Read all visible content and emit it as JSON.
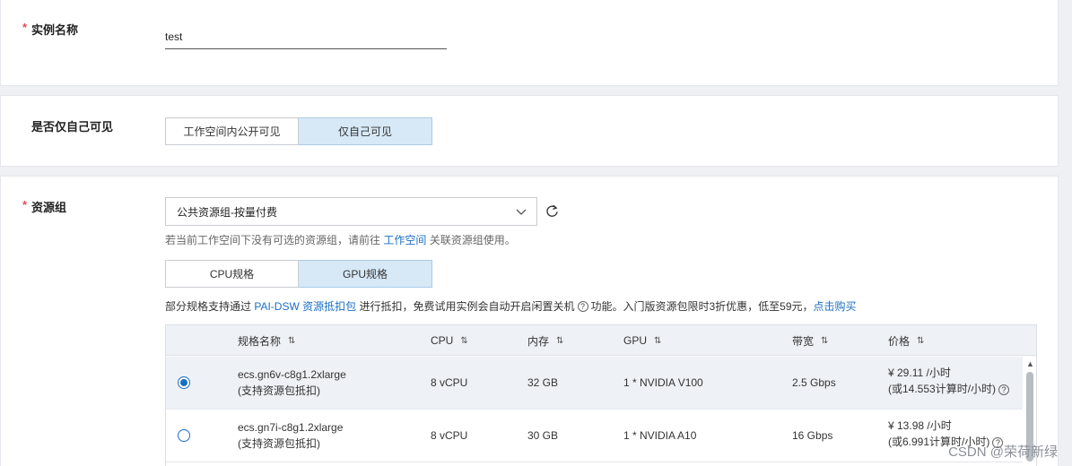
{
  "instance_name": {
    "required_mark": "*",
    "label": "实例名称",
    "value": "test"
  },
  "visibility": {
    "label": "是否仅自己可见",
    "options": [
      "工作空间内公开可见",
      "仅自己可见"
    ],
    "selected": 1
  },
  "resource_group": {
    "required_mark": "*",
    "label": "资源组",
    "select_value": "公共资源组-按量付费",
    "hint_prefix": "若当前工作空间下没有可选的资源组，请前往",
    "hint_link": "工作空间",
    "hint_suffix": "关联资源组使用。",
    "spec_tabs": [
      "CPU规格",
      "GPU规格"
    ],
    "spec_selected": 1,
    "note_prefix": "部分规格支持通过",
    "note_link1": "PAI-DSW 资源抵扣包",
    "note_mid": "进行抵扣，免费试用实例会自动开启闲置关机",
    "note_q": "?",
    "note_suffix": "功能。入门版资源包限时3折优惠，低至59元，",
    "note_link2": "点击购买"
  },
  "table": {
    "headers": [
      "规格名称",
      "CPU",
      "内存",
      "GPU",
      "带宽",
      "价格"
    ],
    "sort_glyph": "⇅",
    "rows": [
      {
        "name": "ecs.gn6v-c8g1.2xlarge",
        "sub": "(支持资源包抵扣)",
        "cpu": "8 vCPU",
        "mem": "32 GB",
        "gpu": "1 * NVIDIA V100",
        "bw": "2.5 Gbps",
        "price": "¥ 29.11 /小时",
        "price_sub": "(或14.553计算时/小时)",
        "selected": true
      },
      {
        "name": "ecs.gn7i-c8g1.2xlarge",
        "sub": "(支持资源包抵扣)",
        "cpu": "8 vCPU",
        "mem": "30 GB",
        "gpu": "1 * NVIDIA A10",
        "bw": "16 Gbps",
        "price": "¥ 13.98 /小时",
        "price_sub": "(或6.991计算时/小时)",
        "selected": false
      }
    ]
  },
  "watermark": "CSDN @荣荷新绿",
  "colors": {
    "accent": "#1a6fc4",
    "required": "#e34d59",
    "active_bg": "#d7e9f7"
  }
}
